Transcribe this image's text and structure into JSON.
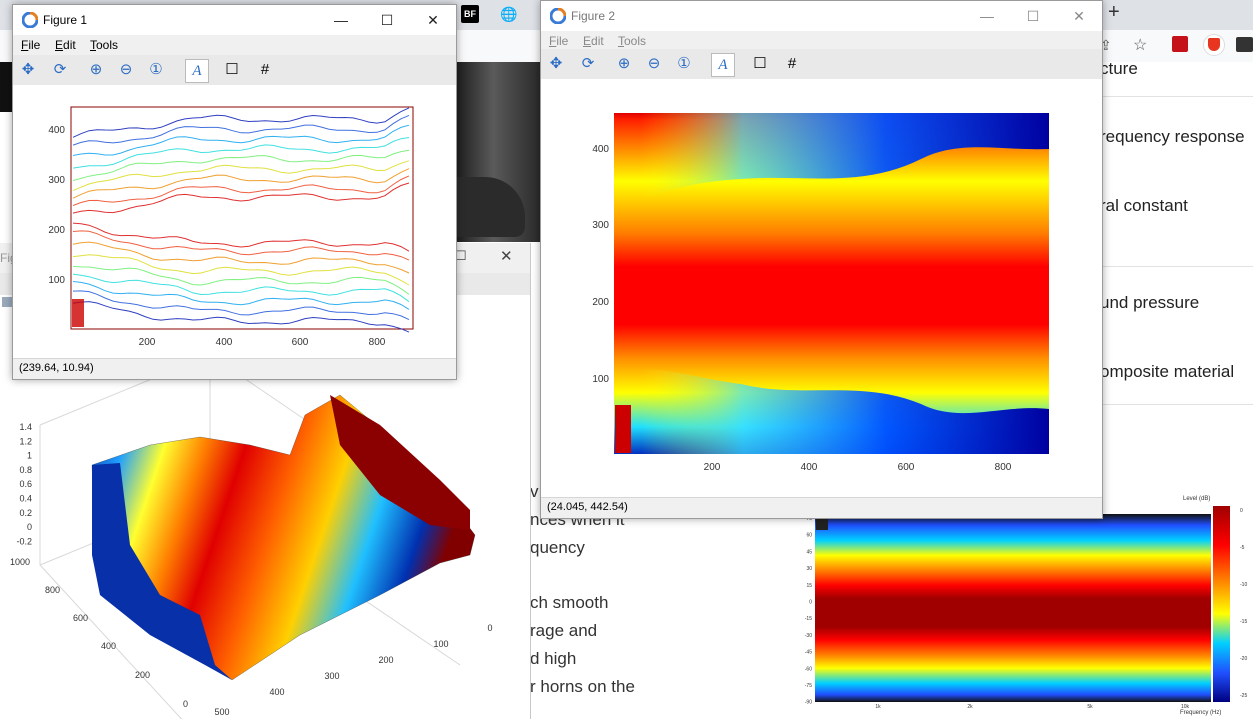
{
  "browser": {
    "tab_icons": [
      "BF",
      "🌐"
    ],
    "new_tab": "+",
    "ext_icons": [
      "share-icon",
      "star-icon",
      "pdf-icon",
      "brave-icon",
      "chat-icon"
    ]
  },
  "article": {
    "items": [
      "cture",
      "requency response",
      "ral constant",
      "und pressure",
      "omposite material"
    ],
    "paragraph": [
      "v",
      "nces when it",
      "quency",
      "",
      "ch smooth",
      "rage and",
      "d high",
      "r horns on the"
    ]
  },
  "figure1": {
    "title": "Figure 1",
    "menu": [
      {
        "key": "F",
        "rest": "ile"
      },
      {
        "key": "E",
        "rest": "dit"
      },
      {
        "key": "T",
        "rest": "ools"
      }
    ],
    "status": "(239.64, 10.94)",
    "x_ticks": [
      "200",
      "400",
      "600",
      "800"
    ],
    "y_ticks": [
      "400",
      "300",
      "200",
      "100"
    ]
  },
  "figure2": {
    "title": "Figure 2",
    "menu": [
      {
        "key": "F",
        "rest": "ile"
      },
      {
        "key": "E",
        "rest": "dit"
      },
      {
        "key": "T",
        "rest": "ools"
      }
    ],
    "status": "(24.045, 442.54)",
    "x_ticks": [
      "200",
      "400",
      "600",
      "800"
    ],
    "y_ticks": [
      "400",
      "300",
      "200",
      "100"
    ]
  },
  "figure3": {
    "title_fragment": "Fig",
    "z_ticks": [
      "1.4",
      "1.2",
      "1",
      "0.8",
      "0.6",
      "0.4",
      "0.2",
      "0",
      "-0.2"
    ],
    "y_ticks": [
      "1000",
      "800",
      "600",
      "400",
      "200",
      "0"
    ],
    "x_ticks": [
      "0",
      "100",
      "200",
      "300",
      "400",
      "500"
    ]
  },
  "rl_plot": {
    "legend_title": "Level (dB)",
    "colorbar_ticks": [
      "0",
      "-5",
      "-10",
      "-15",
      "-20",
      "-25"
    ],
    "y_ticks": [
      "75",
      "60",
      "45",
      "30",
      "15",
      "0",
      "-15",
      "-30",
      "-45",
      "-60",
      "-75",
      "-90"
    ],
    "x_ticks": [
      "1k",
      "2k",
      "5k",
      "10k"
    ],
    "xlabel": "Frequency (Hz)"
  },
  "colors": {
    "jet_red": "#e80000",
    "jet_blue": "#0000b0",
    "window_bg": "#f0f0f0"
  },
  "tools": [
    "pan-icon",
    "rotate-icon",
    "zoom-in-icon",
    "zoom-out-icon",
    "zoom-reset-icon",
    "text-icon",
    "box-icon",
    "grid-icon"
  ]
}
